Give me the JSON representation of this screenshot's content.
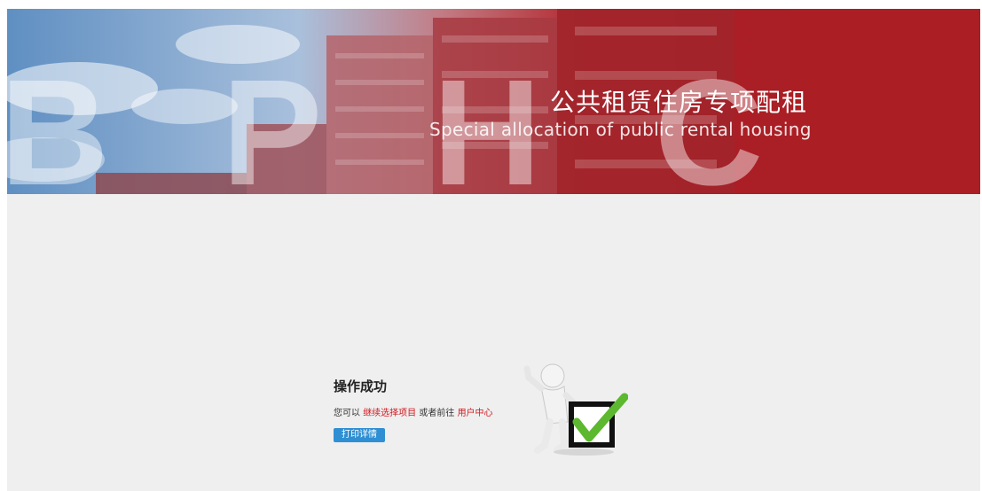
{
  "banner": {
    "watermark": "B P H C",
    "title": "公共租赁住房专项配租",
    "subtitle": "Special allocation of public rental housing"
  },
  "result": {
    "title": "操作成功",
    "prefix": "您可以",
    "link_continue": "继续选择项目",
    "middle": "或者前往",
    "link_user_center": "用户中心",
    "print_button": "打印详情"
  },
  "colors": {
    "banner_red": "#b01e24",
    "link_red": "#d0181f",
    "button_blue": "#2f8fd3",
    "check_green": "#5cb82e"
  }
}
